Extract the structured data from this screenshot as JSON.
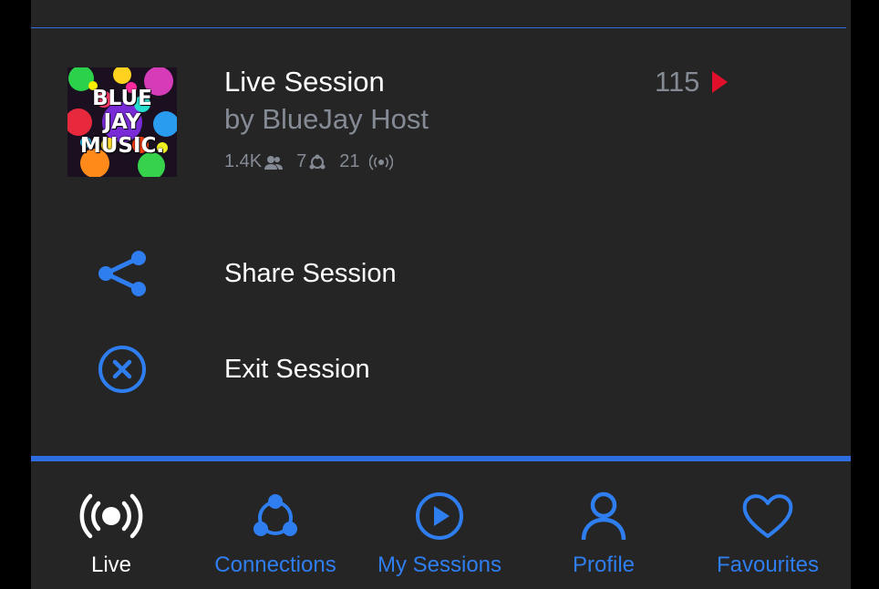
{
  "session": {
    "artwork_lines": [
      "BLUE",
      "JAY",
      "MUSIC."
    ],
    "title": "Live Session",
    "host": "by BlueJay Host",
    "listeners": "1.4K",
    "connections": "7",
    "broadcasts": "21",
    "play_count": "115"
  },
  "menu": {
    "share_label": "Share Session",
    "exit_label": "Exit Session"
  },
  "tabs": [
    {
      "label": "Live",
      "icon": "broadcast-icon",
      "active": true
    },
    {
      "label": "Connections",
      "icon": "connections-icon",
      "active": false
    },
    {
      "label": "My Sessions",
      "icon": "play-circle-icon",
      "active": false
    },
    {
      "label": "Profile",
      "icon": "person-icon",
      "active": false
    },
    {
      "label": "Favourites",
      "icon": "heart-icon",
      "active": false
    }
  ],
  "colors": {
    "accent": "#2f7ef0",
    "background": "#252525",
    "muted_text": "#858b95",
    "play_red": "#e0102a"
  }
}
